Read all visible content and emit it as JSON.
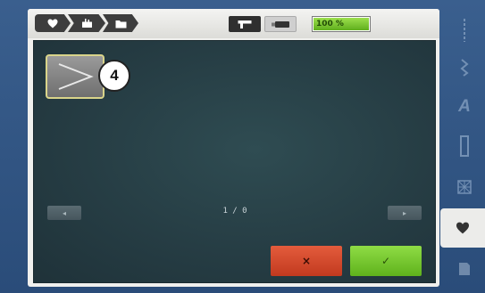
{
  "breadcrumb": {
    "items": [
      {
        "icon": "heart-icon"
      },
      {
        "icon": "embroidery-hoop-icon"
      },
      {
        "icon": "folder-icon"
      }
    ]
  },
  "mode": {
    "active_icon": "sewing-machine-icon",
    "inactive_icon": "usb-stick-icon"
  },
  "battery": {
    "label": "100 %",
    "level_percent": 100,
    "fill_color": "#7cc83a"
  },
  "stitch": {
    "badge": "4",
    "icon": "stitch-chevron-icon"
  },
  "pager": {
    "indicator": "1 / 0",
    "prev_symbol": "◂",
    "next_symbol": "▸"
  },
  "actions": {
    "cancel_label": "×",
    "confirm_label": "✓",
    "cancel_color": "#d9482a",
    "confirm_color": "#7cc83a"
  },
  "sidebar": {
    "items": [
      {
        "icon": "straight-stitch-icon"
      },
      {
        "icon": "zigzag-stitch-icon"
      },
      {
        "icon": "alphabet-icon",
        "text": "A"
      },
      {
        "icon": "buttonhole-icon"
      },
      {
        "icon": "quilt-stitch-icon"
      },
      {
        "icon": "personal-program-heart-icon",
        "active": true
      },
      {
        "icon": "memory-icon"
      }
    ]
  }
}
